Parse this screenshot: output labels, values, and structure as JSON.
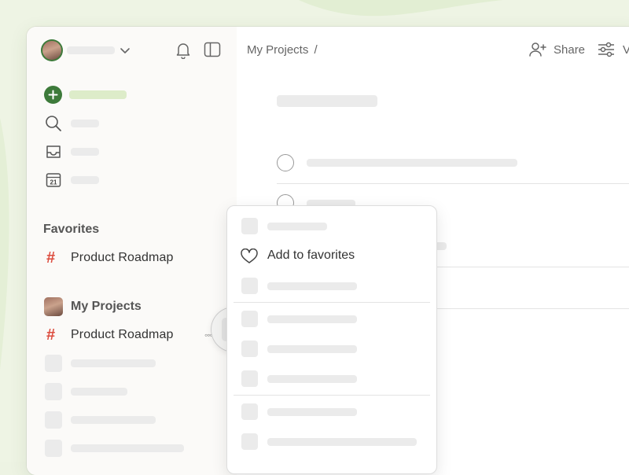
{
  "breadcrumb": {
    "project": "My Projects",
    "separator": "/"
  },
  "header": {
    "share_label": "Share",
    "view_label": "V"
  },
  "sidebar": {
    "favorites_title": "Favorites",
    "favorites": [
      {
        "label": "Product Roadmap",
        "icon": "hash-icon"
      }
    ],
    "my_projects_title": "My Projects",
    "projects": [
      {
        "label": "Product Roadmap",
        "icon": "hash-icon"
      }
    ],
    "more_glyph": "◦◦◦",
    "calendar_day": "21"
  },
  "context_menu": {
    "items": [
      {
        "label": "Add to favorites",
        "icon": "heart-icon"
      }
    ]
  },
  "colors": {
    "accent_green": "#3d7a3a",
    "project_hash": "#dc4c3e",
    "background": "#edf3e3"
  }
}
